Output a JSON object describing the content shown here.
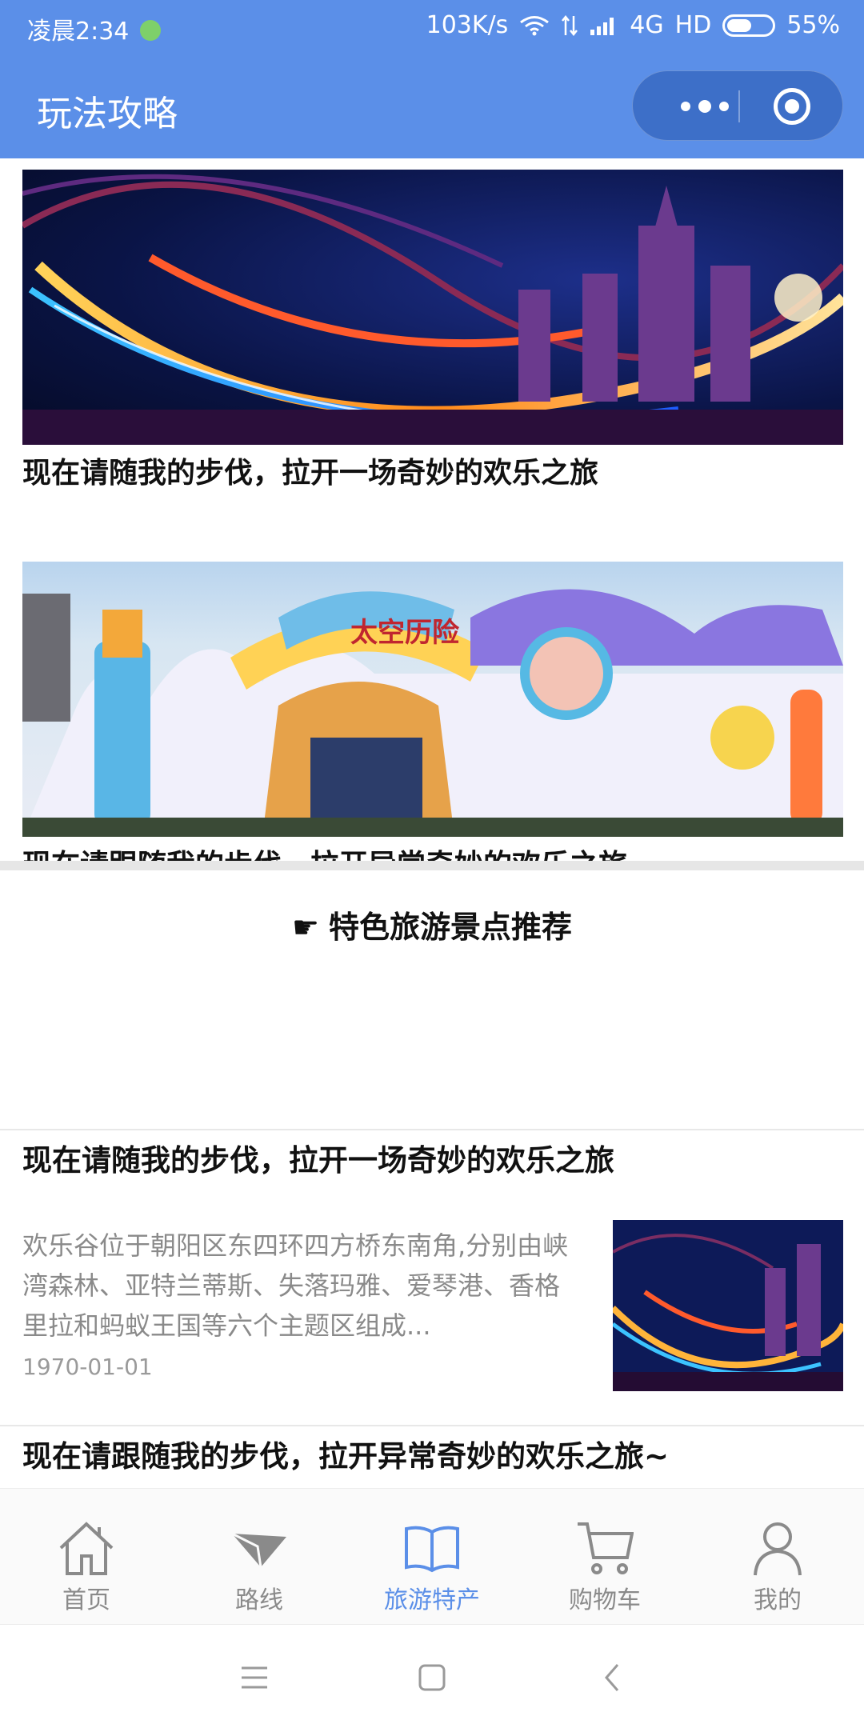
{
  "status_bar": {
    "time": "凌晨2:34",
    "net_speed": "103K/s",
    "network": "4G",
    "hd": "HD",
    "battery": "55%",
    "battery_level": 0.55
  },
  "navbar": {
    "title": "玩法攻略"
  },
  "carousel": {
    "slides": [
      {
        "caption": "现在请随我的步伐，拉开一场奇妙的欢乐之旅"
      },
      {
        "caption": "现在请跟随我的步伐，拉开异常奇妙的欢乐之旅~",
        "sign_text": "太空历险"
      }
    ]
  },
  "section": {
    "hand_icon": "☛",
    "title": "特色旅游景点推荐"
  },
  "articles": [
    {
      "title": "现在请随我的步伐，拉开一场奇妙的欢乐之旅",
      "desc": "欢乐谷位于朝阳区东四环四方桥东南角,分别由峡湾森林、亚特兰蒂斯、失落玛雅、爱琴港、香格里拉和蚂蚁王国等六个主题区组成...",
      "date": "1970-01-01"
    },
    {
      "title": "现在请跟随我的步伐，拉开异常奇妙的欢乐之旅~"
    }
  ],
  "tabbar": {
    "items": [
      {
        "label": "首页",
        "icon": "home-icon"
      },
      {
        "label": "路线",
        "icon": "paper-plane-icon"
      },
      {
        "label": "旅游特产",
        "icon": "book-icon",
        "active": true
      },
      {
        "label": "购物车",
        "icon": "cart-icon"
      },
      {
        "label": "我的",
        "icon": "user-icon"
      }
    ],
    "active_color": "#5b8fe8",
    "inactive_color": "#8a8a8a"
  },
  "theme": {
    "primary": "#5b8fe8"
  }
}
